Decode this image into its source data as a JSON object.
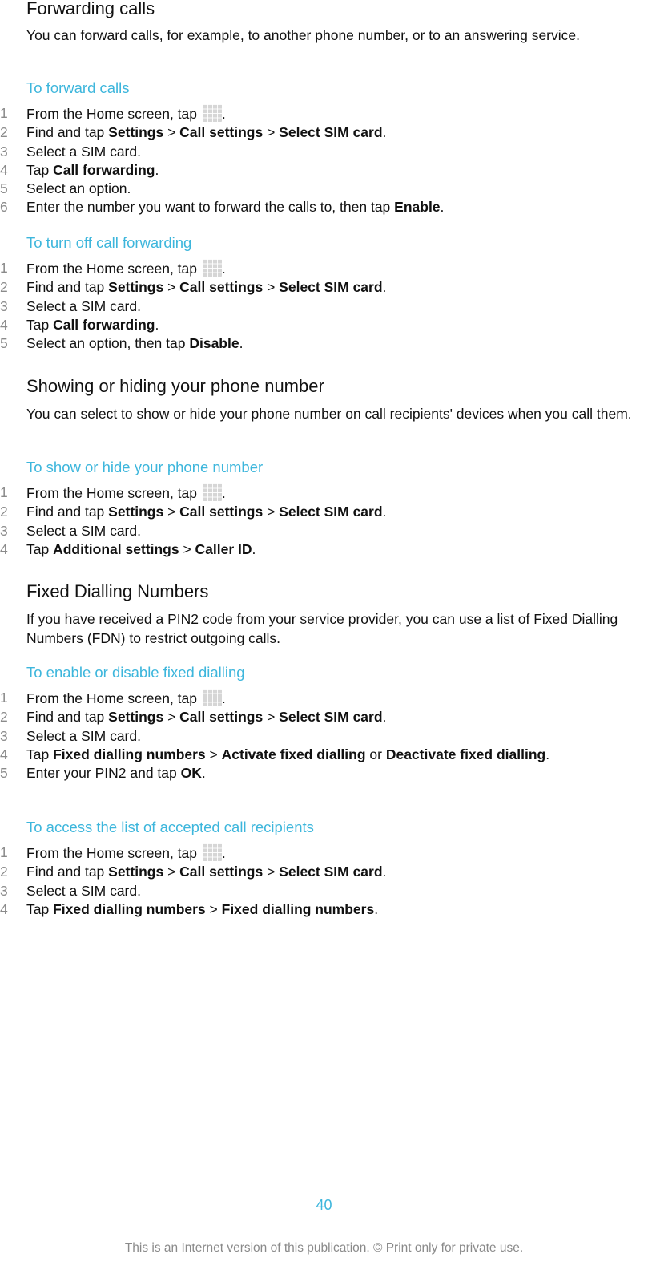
{
  "sections": [
    {
      "title": "Forwarding calls",
      "intro": "You can forward calls, for example, to another phone number, or to an answering service.",
      "procedures": [
        {
          "title": "To forward calls",
          "steps": [
            {
              "num": "1",
              "parts": [
                {
                  "t": "From the Home screen, tap "
                },
                {
                  "icon": "apps-icon"
                },
                {
                  "t": "."
                }
              ]
            },
            {
              "num": "2",
              "parts": [
                {
                  "t": "Find and tap "
                },
                {
                  "b": "Settings"
                },
                {
                  "t": " > "
                },
                {
                  "b": "Call settings"
                },
                {
                  "t": " > "
                },
                {
                  "b": "Select SIM card"
                },
                {
                  "t": "."
                }
              ]
            },
            {
              "num": "3",
              "parts": [
                {
                  "t": "Select a SIM card."
                }
              ]
            },
            {
              "num": "4",
              "parts": [
                {
                  "t": "Tap "
                },
                {
                  "b": "Call forwarding"
                },
                {
                  "t": "."
                }
              ]
            },
            {
              "num": "5",
              "parts": [
                {
                  "t": "Select an option."
                }
              ]
            },
            {
              "num": "6",
              "parts": [
                {
                  "t": "Enter the number you want to forward the calls to, then tap "
                },
                {
                  "b": "Enable"
                },
                {
                  "t": "."
                }
              ]
            }
          ]
        },
        {
          "title": "To turn off call forwarding",
          "steps": [
            {
              "num": "1",
              "parts": [
                {
                  "t": "From the Home screen, tap "
                },
                {
                  "icon": "apps-icon"
                },
                {
                  "t": "."
                }
              ]
            },
            {
              "num": "2",
              "parts": [
                {
                  "t": "Find and tap "
                },
                {
                  "b": "Settings"
                },
                {
                  "t": " > "
                },
                {
                  "b": "Call settings"
                },
                {
                  "t": " > "
                },
                {
                  "b": "Select SIM card"
                },
                {
                  "t": "."
                }
              ]
            },
            {
              "num": "3",
              "parts": [
                {
                  "t": "Select a SIM card."
                }
              ]
            },
            {
              "num": "4",
              "parts": [
                {
                  "t": "Tap "
                },
                {
                  "b": "Call forwarding"
                },
                {
                  "t": "."
                }
              ]
            },
            {
              "num": "5",
              "parts": [
                {
                  "t": "Select an option, then tap "
                },
                {
                  "b": "Disable"
                },
                {
                  "t": "."
                }
              ]
            }
          ]
        }
      ]
    },
    {
      "title": "Showing or hiding your phone number",
      "intro": "You can select to show or hide your phone number on call recipients' devices when you call them.",
      "procedures": [
        {
          "title": "To show or hide your phone number",
          "steps": [
            {
              "num": "1",
              "parts": [
                {
                  "t": "From the Home screen, tap "
                },
                {
                  "icon": "apps-icon"
                },
                {
                  "t": "."
                }
              ]
            },
            {
              "num": "2",
              "parts": [
                {
                  "t": "Find and tap "
                },
                {
                  "b": "Settings"
                },
                {
                  "t": " > "
                },
                {
                  "b": "Call settings"
                },
                {
                  "t": " > "
                },
                {
                  "b": "Select SIM card"
                },
                {
                  "t": "."
                }
              ]
            },
            {
              "num": "3",
              "parts": [
                {
                  "t": "Select a SIM card."
                }
              ]
            },
            {
              "num": "4",
              "parts": [
                {
                  "t": "Tap "
                },
                {
                  "b": "Additional settings"
                },
                {
                  "t": " > "
                },
                {
                  "b": "Caller ID"
                },
                {
                  "t": "."
                }
              ]
            }
          ]
        }
      ]
    },
    {
      "title": "Fixed Dialling Numbers",
      "intro": "If you have received a PIN2 code from your service provider, you can use a list of Fixed Dialling Numbers (FDN) to restrict outgoing calls.",
      "procedures": [
        {
          "title": "To enable or disable fixed dialling",
          "steps": [
            {
              "num": "1",
              "parts": [
                {
                  "t": "From the Home screen, tap "
                },
                {
                  "icon": "apps-icon"
                },
                {
                  "t": "."
                }
              ]
            },
            {
              "num": "2",
              "parts": [
                {
                  "t": "Find and tap "
                },
                {
                  "b": "Settings"
                },
                {
                  "t": " > "
                },
                {
                  "b": "Call settings"
                },
                {
                  "t": " > "
                },
                {
                  "b": "Select SIM card"
                },
                {
                  "t": "."
                }
              ]
            },
            {
              "num": "3",
              "parts": [
                {
                  "t": "Select a SIM card."
                }
              ]
            },
            {
              "num": "4",
              "parts": [
                {
                  "t": "Tap "
                },
                {
                  "b": "Fixed dialling numbers"
                },
                {
                  "t": " > "
                },
                {
                  "b": "Activate fixed dialling"
                },
                {
                  "t": " or "
                },
                {
                  "b": "Deactivate fixed dialling"
                },
                {
                  "t": "."
                }
              ]
            },
            {
              "num": "5",
              "parts": [
                {
                  "t": "Enter your PIN2 and tap "
                },
                {
                  "b": "OK"
                },
                {
                  "t": "."
                }
              ]
            }
          ]
        },
        {
          "title": "To access the list of accepted call recipients",
          "steps": [
            {
              "num": "1",
              "parts": [
                {
                  "t": "From the Home screen, tap "
                },
                {
                  "icon": "apps-icon"
                },
                {
                  "t": "."
                }
              ]
            },
            {
              "num": "2",
              "parts": [
                {
                  "t": "Find and tap "
                },
                {
                  "b": "Settings"
                },
                {
                  "t": " > "
                },
                {
                  "b": "Call settings"
                },
                {
                  "t": " > "
                },
                {
                  "b": "Select SIM card"
                },
                {
                  "t": "."
                }
              ]
            },
            {
              "num": "3",
              "parts": [
                {
                  "t": "Select a SIM card."
                }
              ]
            },
            {
              "num": "4",
              "parts": [
                {
                  "t": "Tap "
                },
                {
                  "b": "Fixed dialling numbers"
                },
                {
                  "t": " > "
                },
                {
                  "b": "Fixed dialling numbers"
                },
                {
                  "t": "."
                }
              ]
            }
          ]
        }
      ]
    }
  ],
  "page_number": "40",
  "footer": "This is an Internet version of this publication. © Print only for private use.",
  "colors": {
    "accent": "#3db6dc",
    "text": "#111111",
    "muted": "#8a8a8a"
  }
}
